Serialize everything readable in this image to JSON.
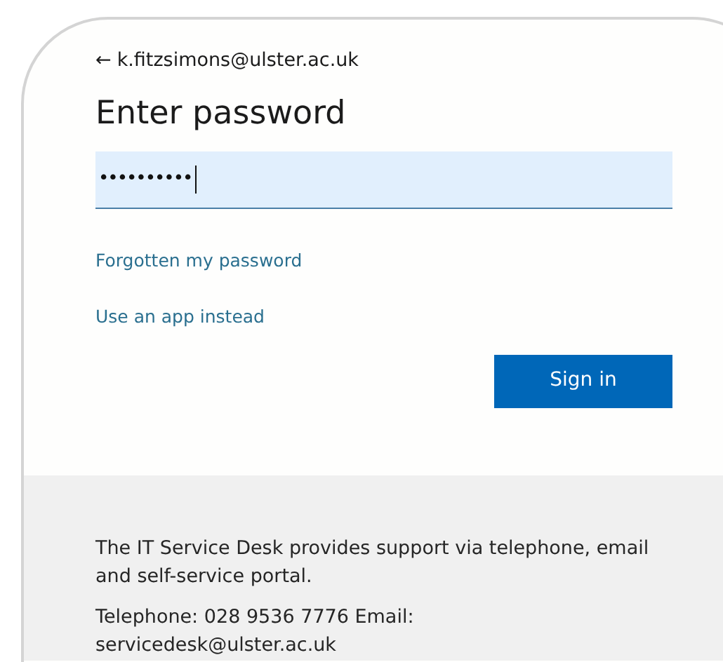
{
  "back_link": {
    "icon": "←",
    "text": "k.fitzsimons@ulster.ac.uk"
  },
  "title": "Enter password",
  "password_field": {
    "value": "••••••••••",
    "focused": true
  },
  "links": [
    "Forgotten my password",
    "Use an app instead"
  ],
  "sign_in_button": "Sign in",
  "footer": {
    "paragraphs": [
      "The IT Service Desk provides support via telephone, email and self-service portal.",
      "Telephone: 028 9536 7776 Email: servicedesk@ulster.ac.uk"
    ]
  }
}
